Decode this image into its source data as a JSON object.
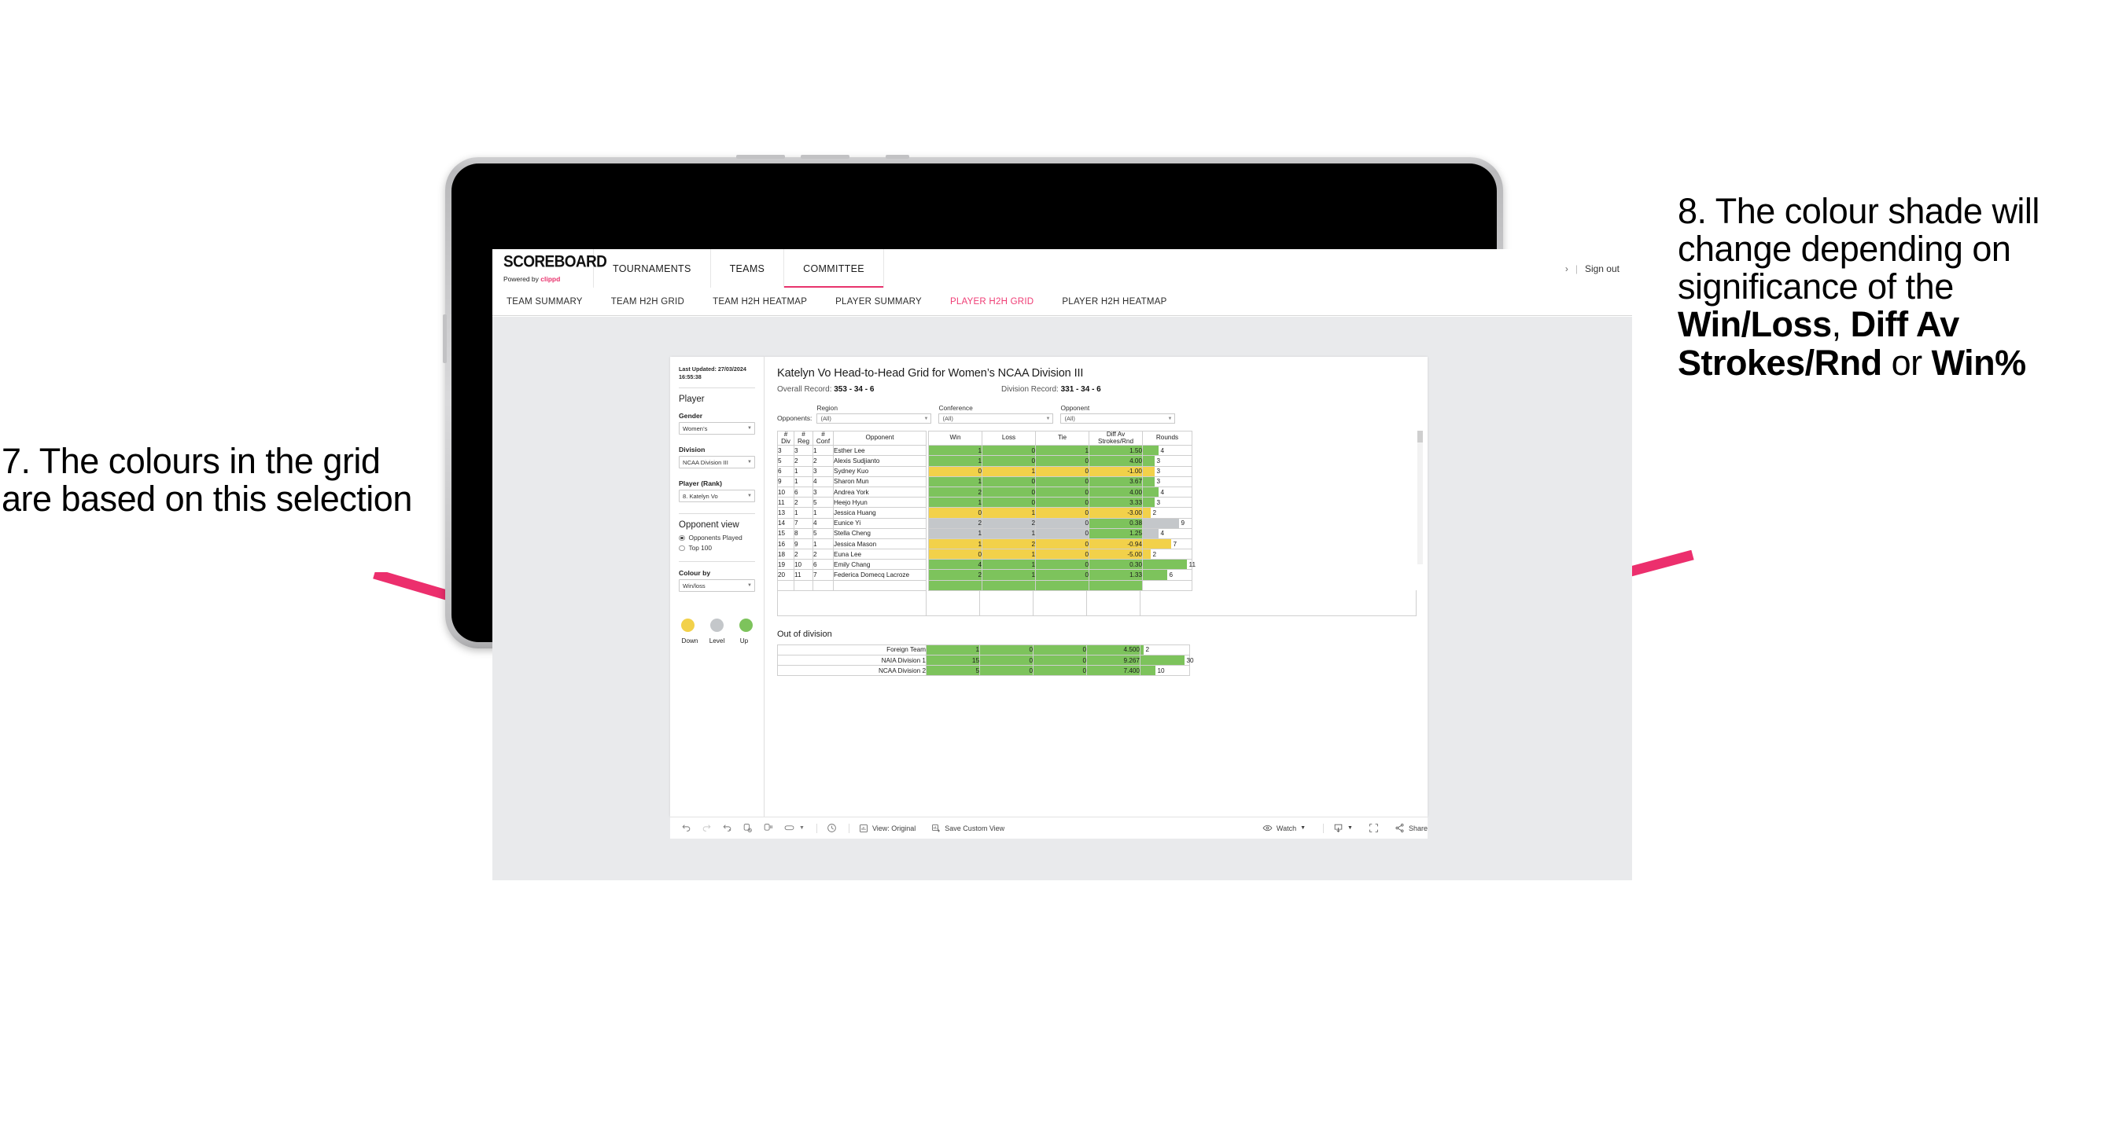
{
  "annotations": {
    "left": "7. The colours in the grid are based on this selection",
    "right_plain_1": "8. The colour shade will change depending on significance of the ",
    "right_bold_1": "Win/Loss",
    "right_plain_2": ", ",
    "right_bold_2": "Diff Av Strokes/Rnd",
    "right_plain_3": " or ",
    "right_bold_3": "Win%",
    "arrow_color": "#e8336d"
  },
  "header": {
    "logo_word": "SCOREBOARD",
    "logo_sub_prefix": "Powered by ",
    "logo_sub_brand": "clippd",
    "nav": [
      {
        "label": "TOURNAMENTS",
        "active": false
      },
      {
        "label": "TEAMS",
        "active": false
      },
      {
        "label": "COMMITTEE",
        "active": true
      }
    ],
    "chevron": "›",
    "divider": "|",
    "sign_out": "Sign out"
  },
  "subnav": {
    "items": [
      {
        "label": "TEAM SUMMARY",
        "active": false
      },
      {
        "label": "TEAM H2H GRID",
        "active": false
      },
      {
        "label": "TEAM H2H HEATMAP",
        "active": false
      },
      {
        "label": "PLAYER SUMMARY",
        "active": false
      },
      {
        "label": "PLAYER H2H GRID",
        "active": true
      },
      {
        "label": "PLAYER H2H HEATMAP",
        "active": false
      }
    ]
  },
  "sidebar": {
    "last_updated": "Last Updated: 27/03/2024 16:55:38",
    "player_heading": "Player",
    "gender_label": "Gender",
    "gender_value": "Women’s",
    "division_label": "Division",
    "division_value": "NCAA Division III",
    "player_rank_label": "Player (Rank)",
    "player_rank_value": "8. Katelyn Vo",
    "opponent_view_heading": "Opponent view",
    "opponent_view_options": [
      {
        "label": "Opponents Played",
        "selected": true
      },
      {
        "label": "Top 100",
        "selected": false
      }
    ],
    "colour_by_label": "Colour by",
    "colour_by_value": "Win/loss",
    "legend": [
      {
        "label": "Down",
        "color": "#f2d14a"
      },
      {
        "label": "Level",
        "color": "#c4c7ca"
      },
      {
        "label": "Up",
        "color": "#7dc35c"
      }
    ]
  },
  "main": {
    "title": "Katelyn Vo Head-to-Head Grid for Women’s NCAA Division III",
    "overall_record_label": "Overall Record: ",
    "overall_record_value": "353 -  34 - 6",
    "division_record_label": "Division Record: ",
    "division_record_value": "331 -  34 - 6",
    "opponents_label": "Opponents:",
    "filters": [
      {
        "label": "Region",
        "value": "(All)"
      },
      {
        "label": "Conference",
        "value": "(All)"
      },
      {
        "label": "Opponent",
        "value": "(All)"
      }
    ],
    "columns": [
      "# Div",
      "# Reg",
      "# Conf",
      "Opponent",
      "Win",
      "Loss",
      "Tie",
      "Diff Av Strokes/Rnd",
      "Rounds"
    ],
    "column_lines": [
      [
        "#",
        "Div"
      ],
      [
        "#",
        "Reg"
      ],
      [
        "#",
        "Conf"
      ],
      [
        "Opponent",
        ""
      ],
      [
        "Win",
        ""
      ],
      [
        "Loss",
        ""
      ],
      [
        "Tie",
        ""
      ],
      [
        "Diff Av",
        "Strokes/Rnd"
      ],
      [
        "Rounds",
        ""
      ]
    ],
    "out_of_division_title": "Out of division"
  },
  "chart_data": {
    "type": "table",
    "title": "Katelyn Vo Head-to-Head Grid for Women’s NCAA Division III",
    "columns": [
      "# Div",
      "# Reg",
      "# Conf",
      "Opponent",
      "Win",
      "Loss",
      "Tie",
      "Diff Av Strokes/Rnd",
      "Rounds"
    ],
    "colour_scale": {
      "up": "#7dc35c",
      "level": "#c4c7ca",
      "down": "#f2d14a"
    },
    "rounds_max": 11,
    "rows": [
      {
        "div": "3",
        "reg": "3",
        "conf": "1",
        "opponent": "Esther Lee",
        "win": "1",
        "loss": "0",
        "tie": "1",
        "diff": "1.50",
        "rounds": 4,
        "colour": "up"
      },
      {
        "div": "5",
        "reg": "2",
        "conf": "2",
        "opponent": "Alexis Sudjianto",
        "win": "1",
        "loss": "0",
        "tie": "0",
        "diff": "4.00",
        "rounds": 3,
        "colour": "up"
      },
      {
        "div": "6",
        "reg": "1",
        "conf": "3",
        "opponent": "Sydney Kuo",
        "win": "0",
        "loss": "1",
        "tie": "0",
        "diff": "-1.00",
        "rounds": 3,
        "colour": "down"
      },
      {
        "div": "9",
        "reg": "1",
        "conf": "4",
        "opponent": "Sharon Mun",
        "win": "1",
        "loss": "0",
        "tie": "0",
        "diff": "3.67",
        "rounds": 3,
        "colour": "up"
      },
      {
        "div": "10",
        "reg": "6",
        "conf": "3",
        "opponent": "Andrea York",
        "win": "2",
        "loss": "0",
        "tie": "0",
        "diff": "4.00",
        "rounds": 4,
        "colour": "up"
      },
      {
        "div": "11",
        "reg": "2",
        "conf": "5",
        "opponent": "Heejo Hyun",
        "win": "1",
        "loss": "0",
        "tie": "0",
        "diff": "3.33",
        "rounds": 3,
        "colour": "up"
      },
      {
        "div": "13",
        "reg": "1",
        "conf": "1",
        "opponent": "Jessica Huang",
        "win": "0",
        "loss": "1",
        "tie": "0",
        "diff": "-3.00",
        "rounds": 2,
        "colour": "down"
      },
      {
        "div": "14",
        "reg": "7",
        "conf": "4",
        "opponent": "Eunice Yi",
        "win": "2",
        "loss": "2",
        "tie": "0",
        "diff": "0.38",
        "rounds": 9,
        "colour": "level"
      },
      {
        "div": "15",
        "reg": "8",
        "conf": "5",
        "opponent": "Stella Cheng",
        "win": "1",
        "loss": "1",
        "tie": "0",
        "diff": "1.25",
        "rounds": 4,
        "colour": "level"
      },
      {
        "div": "16",
        "reg": "9",
        "conf": "1",
        "opponent": "Jessica Mason",
        "win": "1",
        "loss": "2",
        "tie": "0",
        "diff": "-0.94",
        "rounds": 7,
        "colour": "down"
      },
      {
        "div": "18",
        "reg": "2",
        "conf": "2",
        "opponent": "Euna Lee",
        "win": "0",
        "loss": "1",
        "tie": "0",
        "diff": "-5.00",
        "rounds": 2,
        "colour": "down"
      },
      {
        "div": "19",
        "reg": "10",
        "conf": "6",
        "opponent": "Emily Chang",
        "win": "4",
        "loss": "1",
        "tie": "0",
        "diff": "0.30",
        "rounds": 11,
        "colour": "up"
      },
      {
        "div": "20",
        "reg": "11",
        "conf": "7",
        "opponent": "Federica Domecq Lacroze",
        "win": "2",
        "loss": "1",
        "tie": "0",
        "diff": "1.33",
        "rounds": 6,
        "colour": "up"
      }
    ],
    "out_of_division_rows": [
      {
        "opponent": "Foreign Team",
        "win": "1",
        "loss": "0",
        "tie": "0",
        "diff": "4.500",
        "rounds": 2,
        "colour": "up"
      },
      {
        "opponent": "NAIA Division 1",
        "win": "15",
        "loss": "0",
        "tie": "0",
        "diff": "9.267",
        "rounds": 30,
        "colour": "up"
      },
      {
        "opponent": "NCAA Division 2",
        "win": "5",
        "loss": "0",
        "tie": "0",
        "diff": "7.400",
        "rounds": 10,
        "colour": "up"
      }
    ],
    "out_of_division_rounds_max": 30
  },
  "toolbar": {
    "icons": [
      "undo-icon",
      "redo-icon",
      "revert-icon",
      "refresh-icon",
      "pause-icon",
      "highlight-icon",
      "caret-icon"
    ],
    "clock_icon": "clock-icon",
    "view_label": "View: Original",
    "save_label": "Save Custom View",
    "watch_label": "Watch",
    "download_icon": "download-icon",
    "fullscreen_icon": "fullscreen-icon",
    "share_label": "Share"
  }
}
